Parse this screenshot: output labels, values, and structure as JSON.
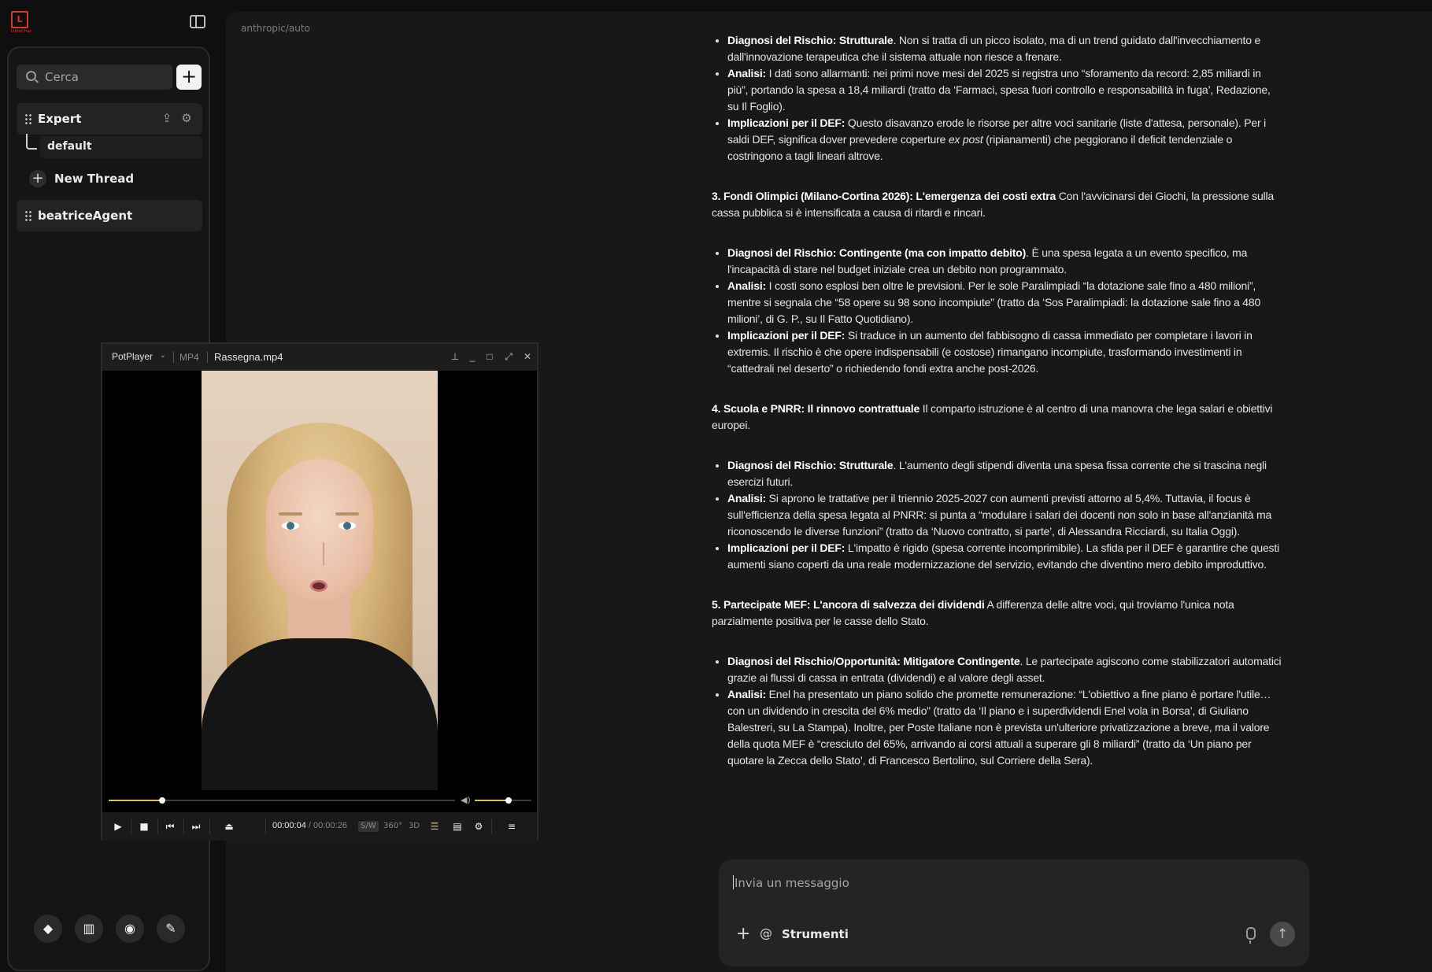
{
  "app": {
    "logo_text": "L",
    "logo_caption": "LibreChat"
  },
  "sidebar": {
    "search_placeholder": "Cerca",
    "add_label": "+",
    "groups": [
      {
        "label": "Expert"
      },
      {
        "label": "beatriceAgent"
      }
    ],
    "thread": "default",
    "new_thread_label": "New Thread",
    "footer_icons": [
      "github-icon",
      "book-icon",
      "discord-icon",
      "wrench-icon"
    ]
  },
  "main": {
    "model": "anthropic/auto",
    "sections": [
      {
        "items": [
          {
            "head": "Diagnosi del Rischio: Strutturale",
            "text": ". Non si tratta di un picco isolato, ma di un trend guidato dall'invecchiamento e dall'innovazione terapeutica che il sistema attuale non riesce a frenare."
          },
          {
            "head": "Analisi:",
            "text": " I dati sono allarmanti: nei primi nove mesi del 2025 si registra uno “sforamento da record: 2,85 miliardi in più”, portando la spesa a 18,4 miliardi (tratto da ‘Farmaci, spesa fuori controllo e responsabilità in fuga’, Redazione, su Il Foglio)."
          },
          {
            "head": "Implicazioni per il DEF:",
            "text": " Questo disavanzo erode le risorse per altre voci sanitarie (liste d'attesa, personale). Per i saldi DEF, significa dover prevedere coperture ",
            "em": "ex post",
            "text2": " (ripianamenti) che peggiorano il deficit tendenziale o costringono a tagli lineari altrove."
          }
        ]
      },
      {
        "title": "3. Fondi Olimpici (Milano-Cortina 2026): L'emergenza dei costi extra",
        "intro": " Con l'avvicinarsi dei Giochi, la pressione sulla cassa pubblica si è intensificata a causa di ritardi e rincari.",
        "items": [
          {
            "head": "Diagnosi del Rischio: Contingente (ma con impatto debito)",
            "text": ". È una spesa legata a un evento specifico, ma l'incapacità di stare nel budget iniziale crea un debito non programmato."
          },
          {
            "head": "Analisi:",
            "text": " I costi sono esplosi ben oltre le previsioni. Per le sole Paralimpiadi “la dotazione sale fino a 480 milioni”, mentre si segnala che “58 opere su 98 sono incompiute” (tratto da ‘Sos Paralimpiadi: la dotazione sale fino a 480 milioni’, di G. P., su Il Fatto Quotidiano)."
          },
          {
            "head": "Implicazioni per il DEF:",
            "text": " Si traduce in un aumento del fabbisogno di cassa immediato per completare i lavori in extremis. Il rischio è che opere indispensabili (e costose) rimangano incompiute, trasformando investimenti in “cattedrali nel deserto” o richiedendo fondi extra anche post-2026."
          }
        ]
      },
      {
        "title": "4. Scuola e PNRR: Il rinnovo contrattuale",
        "intro": " Il comparto istruzione è al centro di una manovra che lega salari e obiettivi europei.",
        "items": [
          {
            "head": "Diagnosi del Rischio: Strutturale",
            "text": ". L'aumento degli stipendi diventa una spesa fissa corrente che si trascina negli esercizi futuri."
          },
          {
            "head": "Analisi:",
            "text": " Si aprono le trattative per il triennio 2025-2027 con aumenti previsti attorno al 5,4%. Tuttavia, il focus è sull'efficienza della spesa legata al PNRR: si punta a “modulare i salari dei docenti non solo in base all'anzianità ma riconoscendo le diverse funzioni” (tratto da ‘Nuovo contratto, si parte’, di Alessandra Ricciardi, su Italia Oggi)."
          },
          {
            "head": "Implicazioni per il DEF:",
            "text": " L'impatto è rigido (spesa corrente incomprimibile). La sfida per il DEF è garantire che questi aumenti siano coperti da una reale modernizzazione del servizio, evitando che diventino mero debito improduttivo."
          }
        ]
      },
      {
        "title": "5. Partecipate MEF: L'ancora di salvezza dei dividendi",
        "intro": " A differenza delle altre voci, qui troviamo l'unica nota parzialmente positiva per le casse dello Stato.",
        "items": [
          {
            "head": "Diagnosi del Rischio/Opportunità: Mitigatore Contingente",
            "text": ". Le partecipate agiscono come stabilizzatori automatici grazie ai flussi di cassa in entrata (dividendi) e al valore degli asset."
          },
          {
            "head": "Analisi:",
            "text": " Enel ha presentato un piano solido che promette remunerazione: “L'obiettivo a fine piano è portare l'utile… con un dividendo in crescita del 6% medio” (tratto da ‘Il piano e i superdividendi Enel vola in Borsa’, di Giuliano Balestreri, su La Stampa). Inoltre, per Poste Italiane non è prevista un'ulteriore privatizzazione a breve, ma il valore della quota MEF è “cresciuto del 65%, arrivando ai corsi attuali a superare gli 8 miliardi” (tratto da ‘Un piano per quotare la Zecca dello Stato’, di Francesco Bertolino, sul Corriere della Sera)."
          }
        ]
      }
    ],
    "composer": {
      "placeholder": "Invia un messaggio",
      "plus": "+",
      "at": "@",
      "tools_label": "Strumenti",
      "send": "↑"
    }
  },
  "player": {
    "brand": "PotPlayer",
    "format": "MP4",
    "filename": "Rassegna.mp4",
    "time_current": "00:00:04",
    "time_sep": "/",
    "time_total": "00:00:26",
    "progress": 0.154,
    "volume": 0.6,
    "tag_sw": "S/W",
    "tag_360": "360°",
    "tag_3d": "3D"
  }
}
